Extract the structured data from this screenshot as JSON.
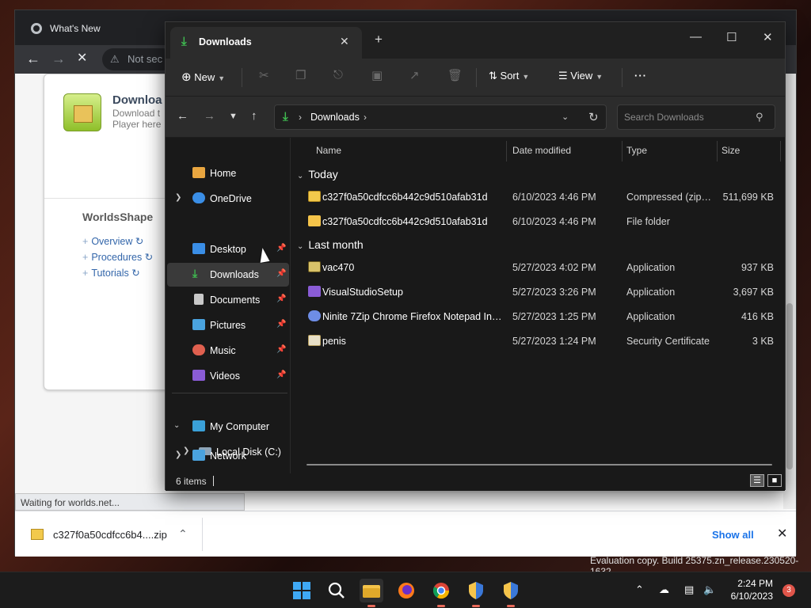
{
  "chrome": {
    "tab_title": "What's New",
    "omnibox_text": "Not sec",
    "page": {
      "download_title": "Downloa",
      "download_sub1": "Download t",
      "download_sub2": "Player here",
      "section_title": "WorldsShape",
      "links": [
        "Overview",
        "Procedures",
        "Tutorials"
      ]
    },
    "status_text": "Waiting for worlds.net...",
    "download_bar": {
      "file_name": "c327f0a50cdfcc6b4....zip",
      "show_all": "Show all"
    }
  },
  "explorer": {
    "tab_title": "Downloads",
    "toolbar": {
      "new_label": "New",
      "sort_label": "Sort",
      "view_label": "View"
    },
    "address": {
      "segment": "Downloads"
    },
    "search": {
      "placeholder": "Search Downloads"
    },
    "nav": {
      "home": "Home",
      "onedrive": "OneDrive",
      "quick_access": [
        {
          "label": "Desktop",
          "color": "#3a8ee6"
        },
        {
          "label": "Downloads",
          "color": "#3fb950"
        },
        {
          "label": "Documents",
          "color": "#c8c8c8"
        },
        {
          "label": "Pictures",
          "color": "#4aa3df"
        },
        {
          "label": "Music",
          "color": "#e0604f"
        },
        {
          "label": "Videos",
          "color": "#8a5cd6"
        }
      ],
      "my_computer": "My Computer",
      "local_disk": "Local Disk (C:)",
      "network": "Network"
    },
    "columns": {
      "name": "Name",
      "date": "Date modified",
      "type": "Type",
      "size": "Size"
    },
    "groups": [
      {
        "label": "Today",
        "files": [
          {
            "name": "c327f0a50cdfcc6b442c9d510afab31d",
            "date": "6/10/2023 4:46 PM",
            "type": "Compressed (zipp...",
            "size": "511,699 KB",
            "icon": "zip-folder-icon"
          },
          {
            "name": "c327f0a50cdfcc6b442c9d510afab31d",
            "date": "6/10/2023 4:46 PM",
            "type": "File folder",
            "size": "",
            "icon": "folder-icon"
          }
        ]
      },
      {
        "label": "Last month",
        "files": [
          {
            "name": "vac470",
            "date": "5/27/2023 4:02 PM",
            "type": "Application",
            "size": "937 KB",
            "icon": "app-icon"
          },
          {
            "name": "VisualStudioSetup",
            "date": "5/27/2023 3:26 PM",
            "type": "Application",
            "size": "3,697 KB",
            "icon": "visual-studio-icon"
          },
          {
            "name": "Ninite 7Zip Chrome Firefox Notepad Inst...",
            "date": "5/27/2023 1:25 PM",
            "type": "Application",
            "size": "416 KB",
            "icon": "ninite-icon"
          },
          {
            "name": "penis",
            "date": "5/27/2023 1:24 PM",
            "type": "Security Certificate",
            "size": "3 KB",
            "icon": "certificate-icon"
          }
        ]
      }
    ],
    "status": {
      "item_count": "6 items"
    }
  },
  "desktop": {
    "watermark": "Evaluation copy. Build 25375.zn_release.230520-1632",
    "clock_time": "2:24 PM",
    "clock_date": "6/10/2023",
    "notification_count": "3"
  }
}
